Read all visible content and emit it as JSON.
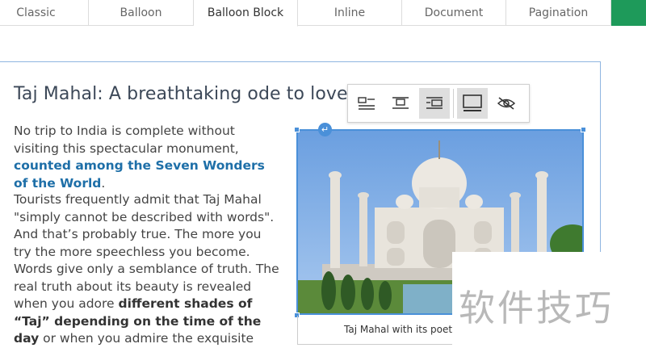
{
  "tabs": [
    "Classic",
    "Balloon",
    "Balloon Block",
    "Inline",
    "Document",
    "Pagination"
  ],
  "active_tab": "Balloon Block",
  "article": {
    "title": "Taj Mahal: A breathtaking ode to love",
    "p1_before": "No trip to India is complete without visiting this spectacular monument, ",
    "p1_link": "counted among the Seven Wonders of the World",
    "p1_after": ".",
    "p2_a": "Tourists frequently admit that Taj Mahal \"simply cannot be described with words\". And that’s probably true. The more you try the more speechless you become. Words give only a semblance of truth. The real truth about its beauty is revealed when you adore ",
    "p2_bold": "different shades of “Taj” depending on the time of the day",
    "p2_b": " or when you admire the exquisite inlay work in different corners of"
  },
  "image": {
    "caption": "Taj Mahal with its poetic"
  },
  "toolbar_icons": [
    "align-left-icon",
    "align-center-icon",
    "align-block-icon",
    "full-width-icon",
    "hide-icon"
  ],
  "watermark": "软件技巧",
  "colors": {
    "selection": "#4a90d9",
    "link": "#1e6fa8",
    "tab_accent": "#1e9a5a"
  }
}
